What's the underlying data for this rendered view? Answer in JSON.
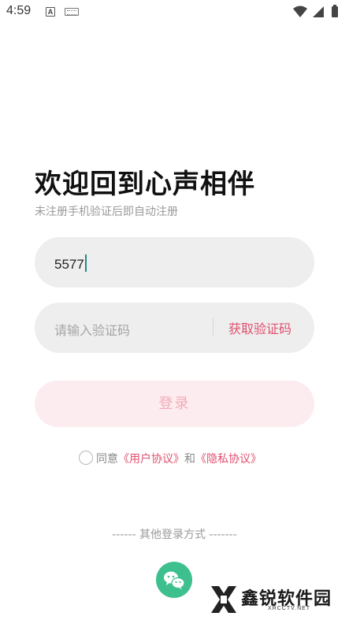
{
  "status_bar": {
    "time": "4:59",
    "a_badge": "A",
    "icons": [
      "a-notification-icon",
      "keyboard-icon",
      "wifi-icon",
      "cellular-signal-icon",
      "battery-icon"
    ]
  },
  "login": {
    "title": "欢迎回到心声相伴",
    "subtitle": "未注册手机验证后即自动注册",
    "phone_value": "5577",
    "code_placeholder": "请输入验证码",
    "get_code_label": "获取验证码",
    "login_label": "登录"
  },
  "agreement": {
    "prefix": "同意",
    "user_agreement": "《用户协议》",
    "and": "和",
    "privacy_agreement": "《隐私协议》"
  },
  "other_login": {
    "title": "------ 其他登录方式 -------",
    "icons": [
      "wechat-icon"
    ]
  },
  "watermark": {
    "text": "鑫锐软件园",
    "sub": "XRCCTV.NET"
  },
  "colors": {
    "accent": "#e0506e",
    "field_bg": "#eeeeee",
    "login_bg": "#fdecef",
    "login_text": "#f2aab8",
    "wechat": "#3ec08e",
    "caret": "#1a8c8c"
  }
}
